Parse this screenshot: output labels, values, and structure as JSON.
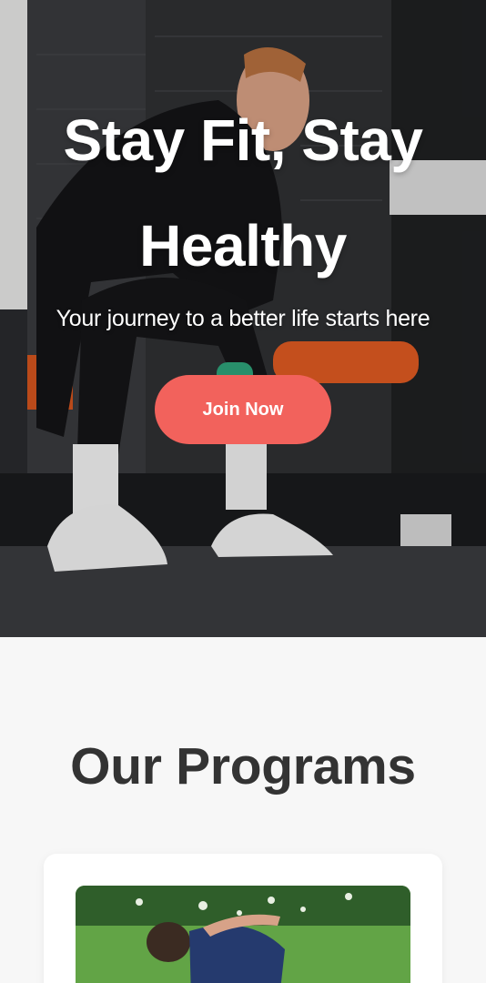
{
  "hero": {
    "title": "Stay Fit, Stay Healthy",
    "subtitle": "Your journey to a better life starts here",
    "cta_label": "Join Now"
  },
  "programs": {
    "heading": "Our Programs"
  },
  "colors": {
    "accent": "#f2625c",
    "heading_text": "#333333",
    "section_bg": "#f7f7f7",
    "card_bg": "#ffffff"
  }
}
